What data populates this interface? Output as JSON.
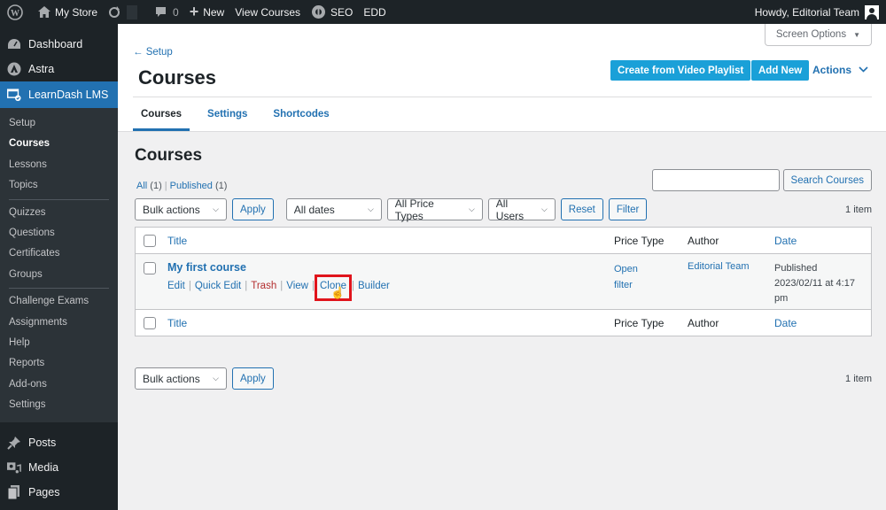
{
  "adminbar": {
    "site_name": "My Store",
    "comments_count": "0",
    "new_label": "New",
    "view_courses": "View Courses",
    "seo": "SEO",
    "edd": "EDD",
    "howdy": "Howdy, Editorial Team"
  },
  "sidebar": {
    "top_items": [
      {
        "label": "Dashboard",
        "icon": "dashboard-icon"
      },
      {
        "label": "Astra",
        "icon": "astra-icon"
      },
      {
        "label": "LearnDash LMS",
        "icon": "learndash-icon",
        "current": true
      }
    ],
    "submenu": [
      "Setup",
      "Courses",
      "Lessons",
      "Topics",
      "Quizzes",
      "Questions",
      "Certificates",
      "Groups",
      "Challenge Exams",
      "Assignments",
      "Help",
      "Reports",
      "Add-ons",
      "Settings"
    ],
    "current_sub": "Courses",
    "bottom_items": [
      {
        "label": "Posts",
        "icon": "pin-icon"
      },
      {
        "label": "Media",
        "icon": "media-icon"
      },
      {
        "label": "Pages",
        "icon": "pages-icon"
      }
    ]
  },
  "header": {
    "screen_options": "Screen Options",
    "back_link": "← Setup",
    "title": "Courses",
    "btn_video": "Create from Video Playlist",
    "btn_add_new": "Add New",
    "actions": "Actions",
    "tabs": [
      "Courses",
      "Settings",
      "Shortcodes"
    ],
    "active_tab": "Courses"
  },
  "list": {
    "heading": "Courses",
    "filters": {
      "all_label": "All",
      "all_count": "(1)",
      "published_label": "Published",
      "published_count": "(1)"
    },
    "search_button": "Search Courses",
    "search_value": "",
    "bulk_actions": "Bulk actions",
    "apply": "Apply",
    "dates": "All dates",
    "price_types": "All Price Types",
    "users": "All Users",
    "reset": "Reset",
    "filter": "Filter",
    "items_count": "1 item",
    "columns": [
      "Title",
      "Price Type",
      "Author",
      "Date"
    ],
    "rows": [
      {
        "title": "My first course",
        "actions": [
          "Edit",
          "Quick Edit",
          "Trash",
          "View",
          "Clone",
          "Builder"
        ],
        "price_type_line1": "Open",
        "price_type_line2": "filter",
        "author": "Editorial Team",
        "date_status": "Published",
        "date_value": "2023/02/11 at 4:17",
        "date_suffix": "pm"
      }
    ],
    "highlighted_action": "Clone"
  },
  "colors": {
    "admin_dark": "#1d2327",
    "accent": "#2271b1",
    "learndash_button": "#1aa0d8",
    "highlight_box": "#e0141c",
    "trash": "#b32d2e"
  }
}
